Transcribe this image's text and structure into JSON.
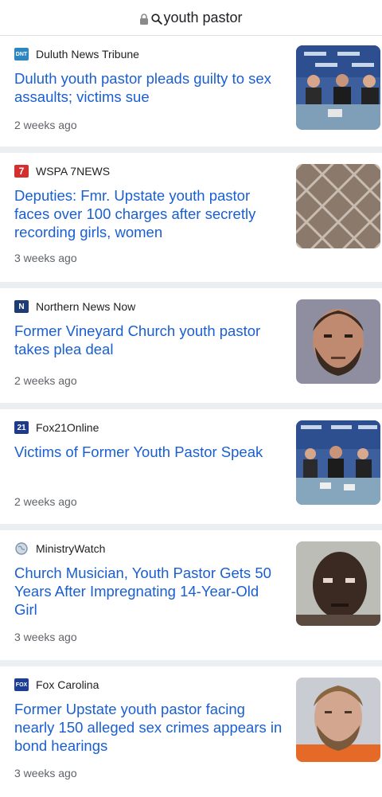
{
  "address_bar": {
    "query": "youth pastor",
    "lock_icon": "lock-icon",
    "search_icon": "search-icon"
  },
  "articles": [
    {
      "source": "Duluth News Tribune",
      "logo_text": "DNT",
      "logo_color": "#2e86c1",
      "headline": "Duluth youth pastor pleads guilty to sex assaults; victims sue",
      "time": "2 weeks ago",
      "thumb": "press-conference-photo"
    },
    {
      "source": "WSPA 7NEWS",
      "logo_text": "7",
      "logo_color": "#d32f2f",
      "headline": "Deputies: Fmr. Upstate youth pastor faces over 100 charges after secretly recording girls, women",
      "time": "3 weeks ago",
      "thumb": "jail-fence-photo"
    },
    {
      "source": "Northern News Now",
      "logo_text": "N",
      "logo_color": "#1f3b73",
      "headline": "Former Vineyard Church youth pastor takes plea deal",
      "time": "2 weeks ago",
      "thumb": "mugshot-photo"
    },
    {
      "source": "Fox21Online",
      "logo_text": "21",
      "logo_color": "#1e3a8a",
      "headline": "Victims of Former Youth Pastor Speak",
      "time": "2 weeks ago",
      "thumb": "press-conference-photo"
    },
    {
      "source": "MinistryWatch",
      "logo_text": "",
      "logo_color": "#7f93a8",
      "headline": "Church Musician, Youth Pastor Gets 50 Years After Impregnating 14-Year-Old Girl",
      "time": "3 weeks ago",
      "thumb": "mugshot-photo"
    },
    {
      "source": "Fox Carolina",
      "logo_text": "FOX",
      "logo_color": "#1c3f94",
      "headline": "Former Upstate youth pastor facing nearly 150 alleged sex crimes appears in bond hearings",
      "time": "3 weeks ago",
      "thumb": "mugshot-photo"
    }
  ]
}
